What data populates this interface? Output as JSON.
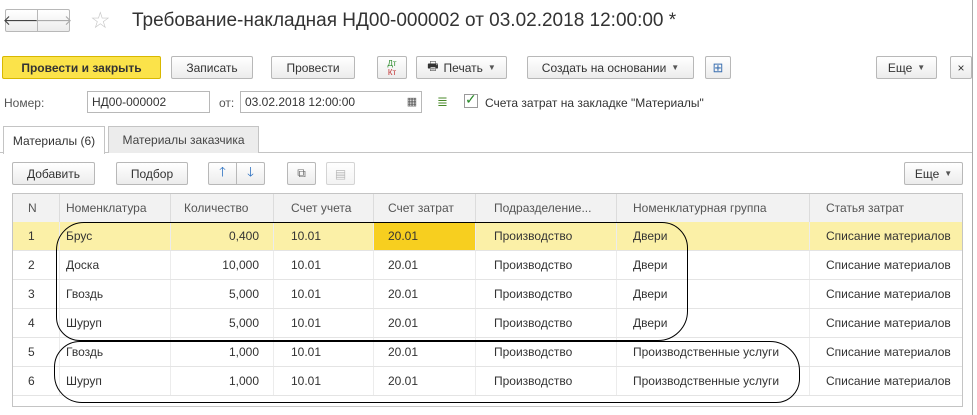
{
  "window": {
    "title": "Требование-накладная НД00-000002 от 03.02.2018 12:00:00 *"
  },
  "toolbar": {
    "post_close": "Провести и закрыть",
    "save": "Записать",
    "post": "Провести",
    "dtkt_top": "Дт",
    "dtkt_bottom": "Кт",
    "print": "Печать",
    "create_based": "Создать на основании",
    "more": "Еще",
    "close": "×"
  },
  "form": {
    "number_label": "Номер:",
    "number_value": "НД00-000002",
    "date_label": "от:",
    "date_value": "03.02.2018 12:00:00",
    "checkbox_label": "Счета затрат на закладке \"Материалы\"",
    "checkbox_checked": true
  },
  "tabs": [
    {
      "label": "Материалы (6)",
      "active": true
    },
    {
      "label": "Материалы заказчика",
      "active": false
    }
  ],
  "table_toolbar": {
    "add": "Добавить",
    "pick": "Подбор",
    "more": "Еще"
  },
  "table": {
    "columns": [
      "N",
      "Номенклатура",
      "Количество",
      "Счет учета",
      "Счет затрат",
      "Подразделение...",
      "Номенклатурная группа",
      "Статья затрат"
    ],
    "rows": [
      [
        "1",
        "Брус",
        "0,400",
        "10.01",
        "20.01",
        "Производство",
        "Двери",
        "Списание материалов"
      ],
      [
        "2",
        "Доска",
        "10,000",
        "10.01",
        "20.01",
        "Производство",
        "Двери",
        "Списание материалов"
      ],
      [
        "3",
        "Гвоздь",
        "5,000",
        "10.01",
        "20.01",
        "Производство",
        "Двери",
        "Списание материалов"
      ],
      [
        "4",
        "Шуруп",
        "5,000",
        "10.01",
        "20.01",
        "Производство",
        "Двери",
        "Списание материалов"
      ],
      [
        "5",
        "Гвоздь",
        "1,000",
        "10.01",
        "20.01",
        "Производство",
        "Производственные услуги",
        "Списание материалов"
      ],
      [
        "6",
        "Шуруп",
        "1,000",
        "10.01",
        "20.01",
        "Производство",
        "Производственные услуги",
        "Списание материалов"
      ]
    ]
  }
}
